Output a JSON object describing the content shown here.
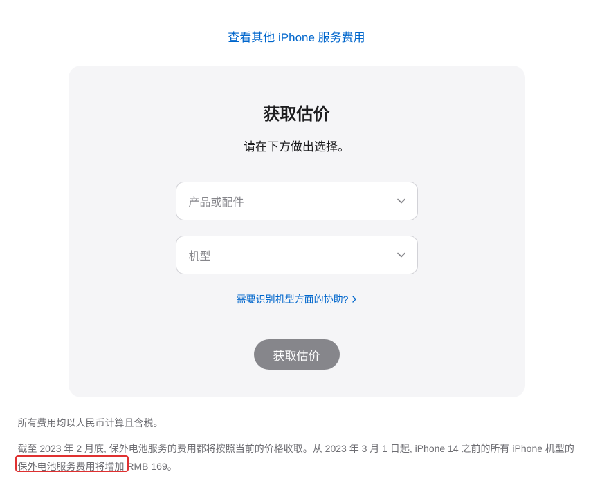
{
  "topLink": {
    "label": "查看其他 iPhone 服务费用"
  },
  "card": {
    "title": "获取估价",
    "subtitle": "请在下方做出选择。",
    "productSelect": {
      "placeholder": "产品或配件"
    },
    "modelSelect": {
      "placeholder": "机型"
    },
    "helpLink": {
      "label": "需要识别机型方面的协助?"
    },
    "submit": {
      "label": "获取估价"
    }
  },
  "footnotes": {
    "line1": "所有费用均以人民币计算且含税。",
    "line2": "截至 2023 年 2 月底, 保外电池服务的费用都将按照当前的价格收取。从 2023 年 3 月 1 日起, iPhone 14 之前的所有 iPhone 机型的保外电池服务费用将增加 RMB 169。"
  }
}
